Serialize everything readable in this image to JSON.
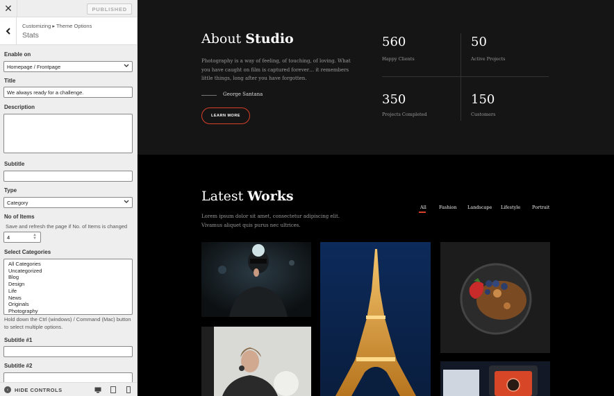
{
  "customizer": {
    "published_label": "PUBLISHED",
    "breadcrumb": "Customizing ▸ Theme Options",
    "section_title": "Stats",
    "fields": {
      "enable_on_label": "Enable on",
      "enable_on_value": "Homepage / Frontpage",
      "title_label": "Title",
      "title_value": "We always ready for a challenge.",
      "description_label": "Description",
      "subtitle_label": "Subtitle",
      "type_label": "Type",
      "type_value": "Category",
      "no_items_label": "No of Items",
      "no_items_help": "Save and refresh the page if No. of Items is changed",
      "no_items_value": "4",
      "select_categories_label": "Select Categories",
      "categories": [
        "All Categories",
        "Uncategorized",
        "Blog",
        "Design",
        "Life",
        "News",
        "Originals",
        "Photography"
      ],
      "categories_help": "Hold down the Ctrl (windows) / Command (Mac) button to select multiple options.",
      "subtitle1_label": "Subtitle #1",
      "subtitle2_label": "Subtitle #2"
    },
    "hide_controls_label": "HIDE CONTROLS"
  },
  "preview": {
    "about": {
      "title_light": "About ",
      "title_bold": "Studio",
      "text": "Photography is a way of feeling, of touching, of loving. What you have caught on film is captured forever… it remembers little things, long after you have forgotten.",
      "signature": "George Santana",
      "button": "LEARN MORE"
    },
    "stats": [
      {
        "number": "560",
        "label": "Happy Clients"
      },
      {
        "number": "50",
        "label": "Active Projects"
      },
      {
        "number": "350",
        "label": "Projects Completed"
      },
      {
        "number": "150",
        "label": "Customers"
      }
    ],
    "works": {
      "title_light": "Latest ",
      "title_bold": "Works",
      "text": "Lorem ipsum dolor sit amet, consectetur adipiscing elit. Vivamus aliquet quis purus nec ultrices.",
      "filters": [
        "All",
        "Fashion",
        "Landscape",
        "Lifestyle",
        "Portrait"
      ],
      "active_filter": "All"
    }
  },
  "colors": {
    "accent": "#d84028",
    "preview_bg": "#151515",
    "panel_bg": "#eeeeee"
  }
}
